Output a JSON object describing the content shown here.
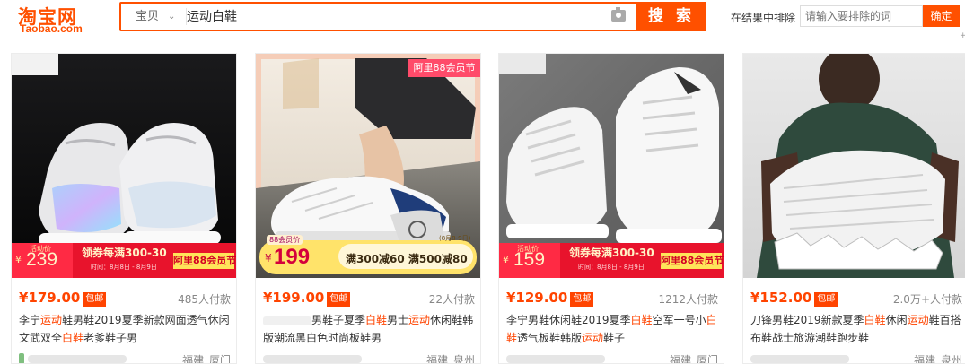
{
  "header": {
    "logo_cn": "淘宝网",
    "logo_en": "Taobao.com",
    "category": "宝贝",
    "query": "运动白鞋",
    "search_button": "搜 索",
    "exclude_label": "在结果中排除",
    "exclude_placeholder": "请输入要排除的词",
    "exclude_button": "确定"
  },
  "products": [
    {
      "price": "¥179.00",
      "badge": "包邮",
      "sold": "485人付款",
      "title_parts": [
        "李宁",
        "运动",
        "鞋男鞋2019夏季新款网面透气休闲文武双全",
        "白鞋",
        "老爹鞋子男"
      ],
      "location": "福建 厦门",
      "banner_tag": "活动价",
      "banner_price": "239",
      "banner_coupon": "领券每满300-30",
      "banner_dates": "时间：8月8日 - 8月9日",
      "banner_event": "阿里88会员节"
    },
    {
      "price": "¥199.00",
      "badge": "包邮",
      "sold": "22人付款",
      "title_parts": [
        "男鞋子夏季",
        "白鞋",
        "男士",
        "运动",
        "休闲鞋韩版潮流黑白色时尚板鞋男"
      ],
      "location": "福建 泉州",
      "corner_tag": "阿里88会员节",
      "banner_tag": "88会员价",
      "banner_price": "199",
      "banner_coupon": "满300减60 满500减80",
      "banner_dates": "(8月8-9日)"
    },
    {
      "price": "¥129.00",
      "badge": "包邮",
      "sold": "1212人付款",
      "title_parts": [
        "李宁男鞋休闲鞋2019夏季",
        "白鞋",
        "空军一号小",
        "白鞋",
        "透气板鞋韩版",
        "运动",
        "鞋子"
      ],
      "location": "福建 厦门",
      "banner_tag": "活动价",
      "banner_price": "159",
      "banner_coupon": "领券每满300-30",
      "banner_dates": "时间：8月8日 - 8月9日",
      "banner_event": "阿里88会员节"
    },
    {
      "price": "¥152.00",
      "badge": "包邮",
      "sold": "2.0万+人付款",
      "title_parts": [
        "刀锋男鞋2019新款夏季",
        "白鞋",
        "休闲",
        "运动",
        "鞋百搭布鞋战士旅游潮鞋跑步鞋"
      ],
      "location": "福建 泉州"
    }
  ]
}
